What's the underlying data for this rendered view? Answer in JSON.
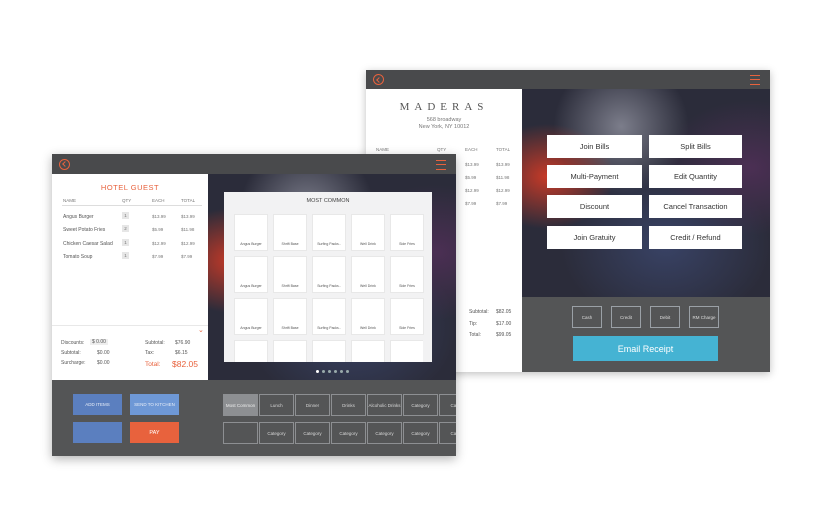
{
  "back_panel": {
    "brand": "MADERAS",
    "address1": "568 broadway",
    "address2": "New York, NY 10012",
    "columns": [
      "NAME",
      "QTY",
      "EACH",
      "TOTAL"
    ],
    "rows": [
      {
        "each": "$13.99",
        "total": "$13.99"
      },
      {
        "each": "$5.99",
        "total": "$11.98"
      },
      {
        "each": "$12.99",
        "total": "$12.99"
      },
      {
        "each": "$7.99",
        "total": "$7.99"
      }
    ],
    "subtotal_label": "Subtotal:",
    "subtotal": "$82.05",
    "tip_label": "Tip:",
    "tip": "$17.00",
    "total_label": "Total:",
    "total": "$99.05",
    "actions": [
      "Join Bills",
      "Split Bills",
      "Multi-Payment",
      "Edit Quantity",
      "Discount",
      "Cancel Transaction",
      "Join Gratuity",
      "Credit / Refund"
    ],
    "payments": [
      "Cash",
      "Credit",
      "Debit",
      "RM Charge"
    ],
    "email_receipt": "Email Receipt"
  },
  "front_panel": {
    "guest_title": "HOTEL GUEST",
    "columns": [
      "NAME",
      "QTY",
      "EACH",
      "TOTAL"
    ],
    "rows": [
      {
        "name": "Angus Burger",
        "qty": "1",
        "each": "$13.99",
        "total": "$13.99"
      },
      {
        "name": "Sweet Potato Fries",
        "qty": "2",
        "each": "$5.99",
        "total": "$11.98"
      },
      {
        "name": "Chicken Caesar Salad",
        "qty": "1",
        "each": "$12.99",
        "total": "$12.99"
      },
      {
        "name": "Tomato Soup",
        "qty": "1",
        "each": "$7.99",
        "total": "$7.99"
      }
    ],
    "discounts_label": "Discounts:",
    "discounts_value": "$ 0.00",
    "subtotal_l_label": "Subtotal:",
    "subtotal_l": "$0.00",
    "surcharge_label": "Surcharge:",
    "surcharge": "$0.00",
    "subtotal_r_label": "Subtotal:",
    "subtotal_r": "$76.90",
    "tax_label": "Tax:",
    "tax": "$6.15",
    "total_label": "Total:",
    "total": "$82.05",
    "buttons": {
      "add_items": "ADD ITEMS",
      "send_to_kitchen": "SEND TO KITCHEN",
      "pay": "PAY"
    },
    "most_common_title": "MOST COMMON",
    "tiles": [
      "Angus Burger",
      "Shrift Base",
      "Surfing Packs..",
      "Well Drink",
      "Side Fries",
      "Angus Burger",
      "Shrift Base",
      "Surfing Packs..",
      "Well Drink",
      "Side Fries",
      "Angus Burger",
      "Shrift Base",
      "Surfing Packs..",
      "Well Drink",
      "Side Fries"
    ],
    "categories_row1": [
      "Most Common",
      "Lunch",
      "Dinner",
      "Drinks",
      "Alcoholic Drinks",
      "Category",
      "Categ"
    ],
    "categories_row2": [
      "",
      "Category",
      "Category",
      "Category",
      "Category",
      "Category",
      "Categ"
    ],
    "colors": {
      "accent": "#e8623d",
      "blue": "#5b7fbf",
      "light_blue": "#6e98d6",
      "cyan": "#45b3d3",
      "dark": "#545556"
    }
  }
}
